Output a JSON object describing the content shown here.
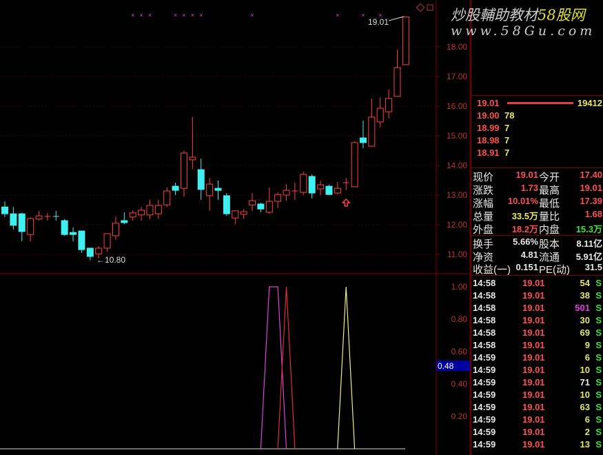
{
  "price_axis": {
    "labels": [
      "18.00",
      "17.00",
      "16.00",
      "15.00",
      "14.00",
      "13.00",
      "12.00",
      "11.00"
    ],
    "values": [
      18,
      17,
      16,
      15,
      14,
      13,
      12,
      11
    ]
  },
  "indicator_axis": {
    "labels": [
      "1.00",
      "0.80",
      "0.60",
      "0.40",
      "0.20"
    ],
    "values": [
      1,
      0.8,
      0.6,
      0.4,
      0.2
    ],
    "cursor_value": "0.48"
  },
  "annotations": {
    "high_label": "19.01",
    "low_label": "←10.80"
  },
  "colors": {
    "up": "#ff4040",
    "down": "#40f0f0",
    "grid": "#800000",
    "axis_text": "#c03030",
    "magenta": "#e040e0",
    "red_line": "#e03030",
    "yellow_line": "#f0f080"
  },
  "candles": [
    [
      12.6,
      12.79,
      12.26,
      12.37
    ],
    [
      12.37,
      12.6,
      11.84,
      11.98
    ],
    [
      12.37,
      12.4,
      11.44,
      11.77
    ],
    [
      11.67,
      12.26,
      11.44,
      12.21
    ],
    [
      12.19,
      12.47,
      12.14,
      12.3
    ],
    [
      12.28,
      12.4,
      12.14,
      12.28
    ],
    [
      12.28,
      12.47,
      12.14,
      12.27
    ],
    [
      12.14,
      12.19,
      11.63,
      11.67
    ],
    [
      11.74,
      11.91,
      11.44,
      11.67
    ],
    [
      11.79,
      11.79,
      11.05,
      11.16
    ],
    [
      11.21,
      11.21,
      10.8,
      10.93
    ],
    [
      11.02,
      11.28,
      10.86,
      11.21
    ],
    [
      11.21,
      11.7,
      11.09,
      11.7
    ],
    [
      11.63,
      12.28,
      11.49,
      12.05
    ],
    [
      12.14,
      12.42,
      12.02,
      12.07
    ],
    [
      12.26,
      12.49,
      12.14,
      12.4
    ],
    [
      12.33,
      12.6,
      12.14,
      12.49
    ],
    [
      12.33,
      12.84,
      12.19,
      12.65
    ],
    [
      12.37,
      12.84,
      12.19,
      12.65
    ],
    [
      12.67,
      13.26,
      12.6,
      13.14
    ],
    [
      13.3,
      13.42,
      13.0,
      13.16
    ],
    [
      13.23,
      14.51,
      12.95,
      14.42
    ],
    [
      14.19,
      15.63,
      13.88,
      14.28
    ],
    [
      13.86,
      14.23,
      12.84,
      13.19
    ],
    [
      12.98,
      13.58,
      12.47,
      13.37
    ],
    [
      13.23,
      13.49,
      12.84,
      13.16
    ],
    [
      12.98,
      13.07,
      12.3,
      12.37
    ],
    [
      12.23,
      12.47,
      12.02,
      12.47
    ],
    [
      12.35,
      12.53,
      12.19,
      12.44
    ],
    [
      12.67,
      13.07,
      12.47,
      12.81
    ],
    [
      12.7,
      12.74,
      12.42,
      12.53
    ],
    [
      12.42,
      13.26,
      12.37,
      12.79
    ],
    [
      12.79,
      13.09,
      12.56,
      13.02
    ],
    [
      13.0,
      13.37,
      12.81,
      13.16
    ],
    [
      13.14,
      13.42,
      12.84,
      13.14
    ],
    [
      13.09,
      13.79,
      13.0,
      13.7
    ],
    [
      13.63,
      13.7,
      12.88,
      13.07
    ],
    [
      13.21,
      13.49,
      13.0,
      13.35
    ],
    [
      13.3,
      13.35,
      13.0,
      13.02
    ],
    [
      13.07,
      13.44,
      13.02,
      13.23
    ],
    [
      13.42,
      13.58,
      13.16,
      13.42
    ],
    [
      13.28,
      14.81,
      13.28,
      14.77
    ],
    [
      14.93,
      15.51,
      14.58,
      14.77
    ],
    [
      14.65,
      16.26,
      14.63,
      15.63
    ],
    [
      15.47,
      16.3,
      15.28,
      15.93
    ],
    [
      15.81,
      16.56,
      15.58,
      16.26
    ],
    [
      16.33,
      17.91,
      16.33,
      17.3
    ],
    [
      17.4,
      19.01,
      17.39,
      19.01
    ]
  ],
  "signal_marks": [
    15,
    16,
    17,
    20,
    21,
    22,
    23,
    29,
    39,
    42,
    44
  ],
  "buy_arrow_index": 40,
  "indicator_series": [
    {
      "name": "magenta",
      "color": "#e040e0",
      "points": [
        [
          30,
          0
        ],
        [
          31,
          1
        ],
        [
          32,
          1
        ],
        [
          33,
          0
        ]
      ]
    },
    {
      "name": "red",
      "color": "#e03030",
      "points": [
        [
          32,
          0
        ],
        [
          33,
          1
        ],
        [
          34,
          0
        ]
      ]
    },
    {
      "name": "yellow",
      "color": "#f0f080",
      "points": [
        [
          39,
          0
        ],
        [
          40,
          1
        ],
        [
          41,
          0
        ]
      ]
    }
  ],
  "watermark": {
    "line1": "炒股輔助教材",
    "line1b": "58股网",
    "line2": "www.58Gu.com"
  },
  "bids": [
    {
      "price": "19.01",
      "vol": "19412"
    },
    {
      "price": "19.00",
      "vol": "78"
    },
    {
      "price": "18.99",
      "vol": "7"
    },
    {
      "price": "18.98",
      "vol": "7"
    },
    {
      "price": "18.91",
      "vol": "7"
    }
  ],
  "quote": [
    {
      "l1": "现价",
      "v1": "19.01",
      "c1": "red",
      "l2": "今开",
      "v2": "17.40",
      "c2": "red"
    },
    {
      "l1": "涨跌",
      "v1": "1.73",
      "c1": "red",
      "l2": "最高",
      "v2": "19.01",
      "c2": "red"
    },
    {
      "l1": "涨幅",
      "v1": "10.01%",
      "c1": "red",
      "l2": "最低",
      "v2": "17.39",
      "c2": "red"
    },
    {
      "l1": "总量",
      "v1": "33.5万",
      "c1": "yel",
      "l2": "量比",
      "v2": "1.68",
      "c2": "red"
    },
    {
      "l1": "外盘",
      "v1": "18.2万",
      "c1": "red",
      "l2": "内盘",
      "v2": "15.3万",
      "c2": "grn"
    }
  ],
  "fundamentals": [
    {
      "l1": "换手",
      "v1": "5.66%",
      "l2": "股本",
      "v2": "8.11亿"
    },
    {
      "l1": "净资",
      "v1": "4.81",
      "l2": "流通",
      "v2": "5.91亿"
    },
    {
      "l1": "收益(一)",
      "v1": "0.151",
      "l2": "PE(动)",
      "v2": "31.5"
    }
  ],
  "ticks": [
    {
      "t": "14:58",
      "p": "19.01",
      "v": "54",
      "c": "yel",
      "s": "S"
    },
    {
      "t": "14:58",
      "p": "19.01",
      "v": "38",
      "c": "yel",
      "s": "S"
    },
    {
      "t": "14:58",
      "p": "19.01",
      "v": "501",
      "c": "mag",
      "s": "S"
    },
    {
      "t": "14:58",
      "p": "19.01",
      "v": "30",
      "c": "yel",
      "s": "S"
    },
    {
      "t": "14:58",
      "p": "19.01",
      "v": "69",
      "c": "yel",
      "s": "S"
    },
    {
      "t": "14:58",
      "p": "19.01",
      "v": "9",
      "c": "yel",
      "s": "S"
    },
    {
      "t": "14:59",
      "p": "19.01",
      "v": "6",
      "c": "yel",
      "s": "S"
    },
    {
      "t": "14:59",
      "p": "19.01",
      "v": "10",
      "c": "yel",
      "s": "S"
    },
    {
      "t": "14:59",
      "p": "19.01",
      "v": "71",
      "c": "wht",
      "s": "S"
    },
    {
      "t": "14:59",
      "p": "19.01",
      "v": "10",
      "c": "yel",
      "s": "S"
    },
    {
      "t": "14:59",
      "p": "19.01",
      "v": "63",
      "c": "yel",
      "s": "S"
    },
    {
      "t": "14:59",
      "p": "19.01",
      "v": "6",
      "c": "yel",
      "s": "S"
    },
    {
      "t": "14:59",
      "p": "19.01",
      "v": "2",
      "c": "yel",
      "s": "S"
    },
    {
      "t": "14:59",
      "p": "19.01",
      "v": "13",
      "c": "yel",
      "s": "S"
    }
  ]
}
